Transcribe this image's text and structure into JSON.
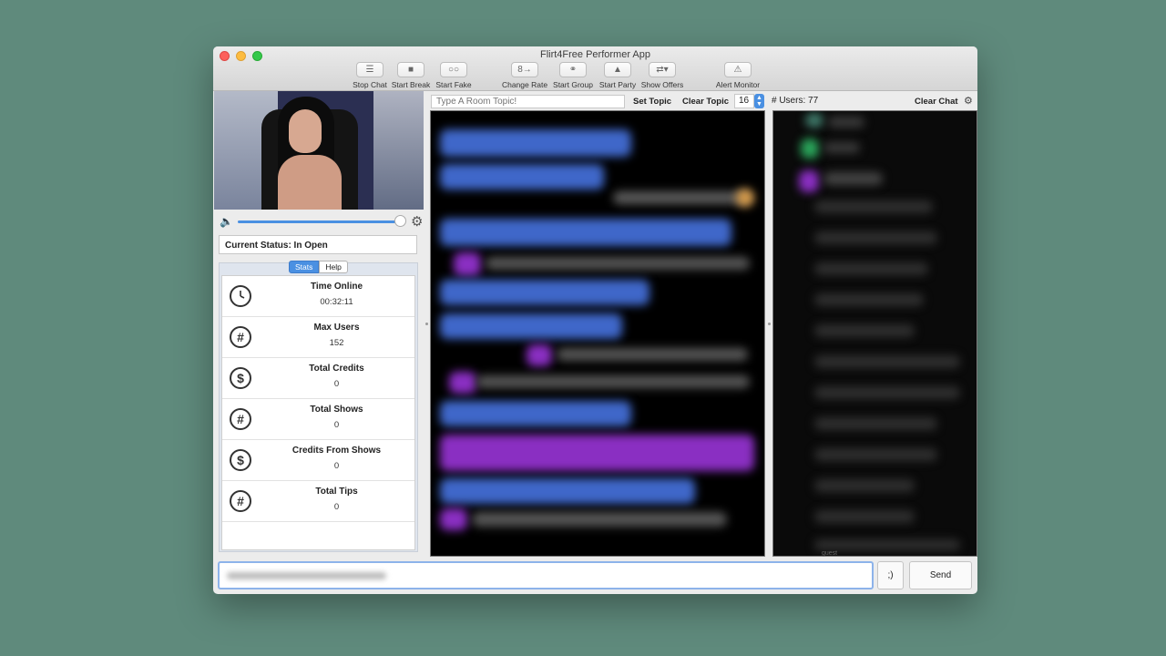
{
  "window": {
    "title": "Flirt4Free Performer App"
  },
  "toolbar": {
    "stop_chat": "Stop Chat",
    "start_break": "Start Break",
    "start_fake": "Start Fake",
    "change_rate": "Change Rate",
    "start_group": "Start Group",
    "start_party": "Start Party",
    "show_offers": "Show Offers",
    "alert_monitor": "Alert Monitor"
  },
  "status": {
    "text": "Current Status: In Open"
  },
  "tabs": {
    "stats": "Stats",
    "help": "Help"
  },
  "stats": [
    {
      "title": "Time Online",
      "value": "00:32:11",
      "icon": "clock-icon"
    },
    {
      "title": "Max Users",
      "value": "152",
      "icon": "hash-icon"
    },
    {
      "title": "Total Credits",
      "value": "0",
      "icon": "dollar-icon"
    },
    {
      "title": "Total Shows",
      "value": "0",
      "icon": "hash-icon"
    },
    {
      "title": "Credits From Shows",
      "value": "0",
      "icon": "dollar-icon"
    },
    {
      "title": "Total Tips",
      "value": "0",
      "icon": "hash-icon"
    }
  ],
  "icon_glyphs": {
    "hash": "#",
    "dollar": "$"
  },
  "topic": {
    "placeholder": "Type A Room Topic!",
    "set_topic": "Set Topic",
    "clear_topic": "Clear Topic",
    "font_size": "16"
  },
  "users": {
    "count_label": "# Users: 77",
    "clear_chat": "Clear Chat",
    "guest_label": "guest"
  },
  "composer": {
    "emoticon": ";)",
    "send": "Send"
  },
  "colors": {
    "accent": "#4a90e2",
    "background": "#5f8a7c",
    "chat_blue": "#3f67c9",
    "chat_purple": "#8a2fc2"
  }
}
